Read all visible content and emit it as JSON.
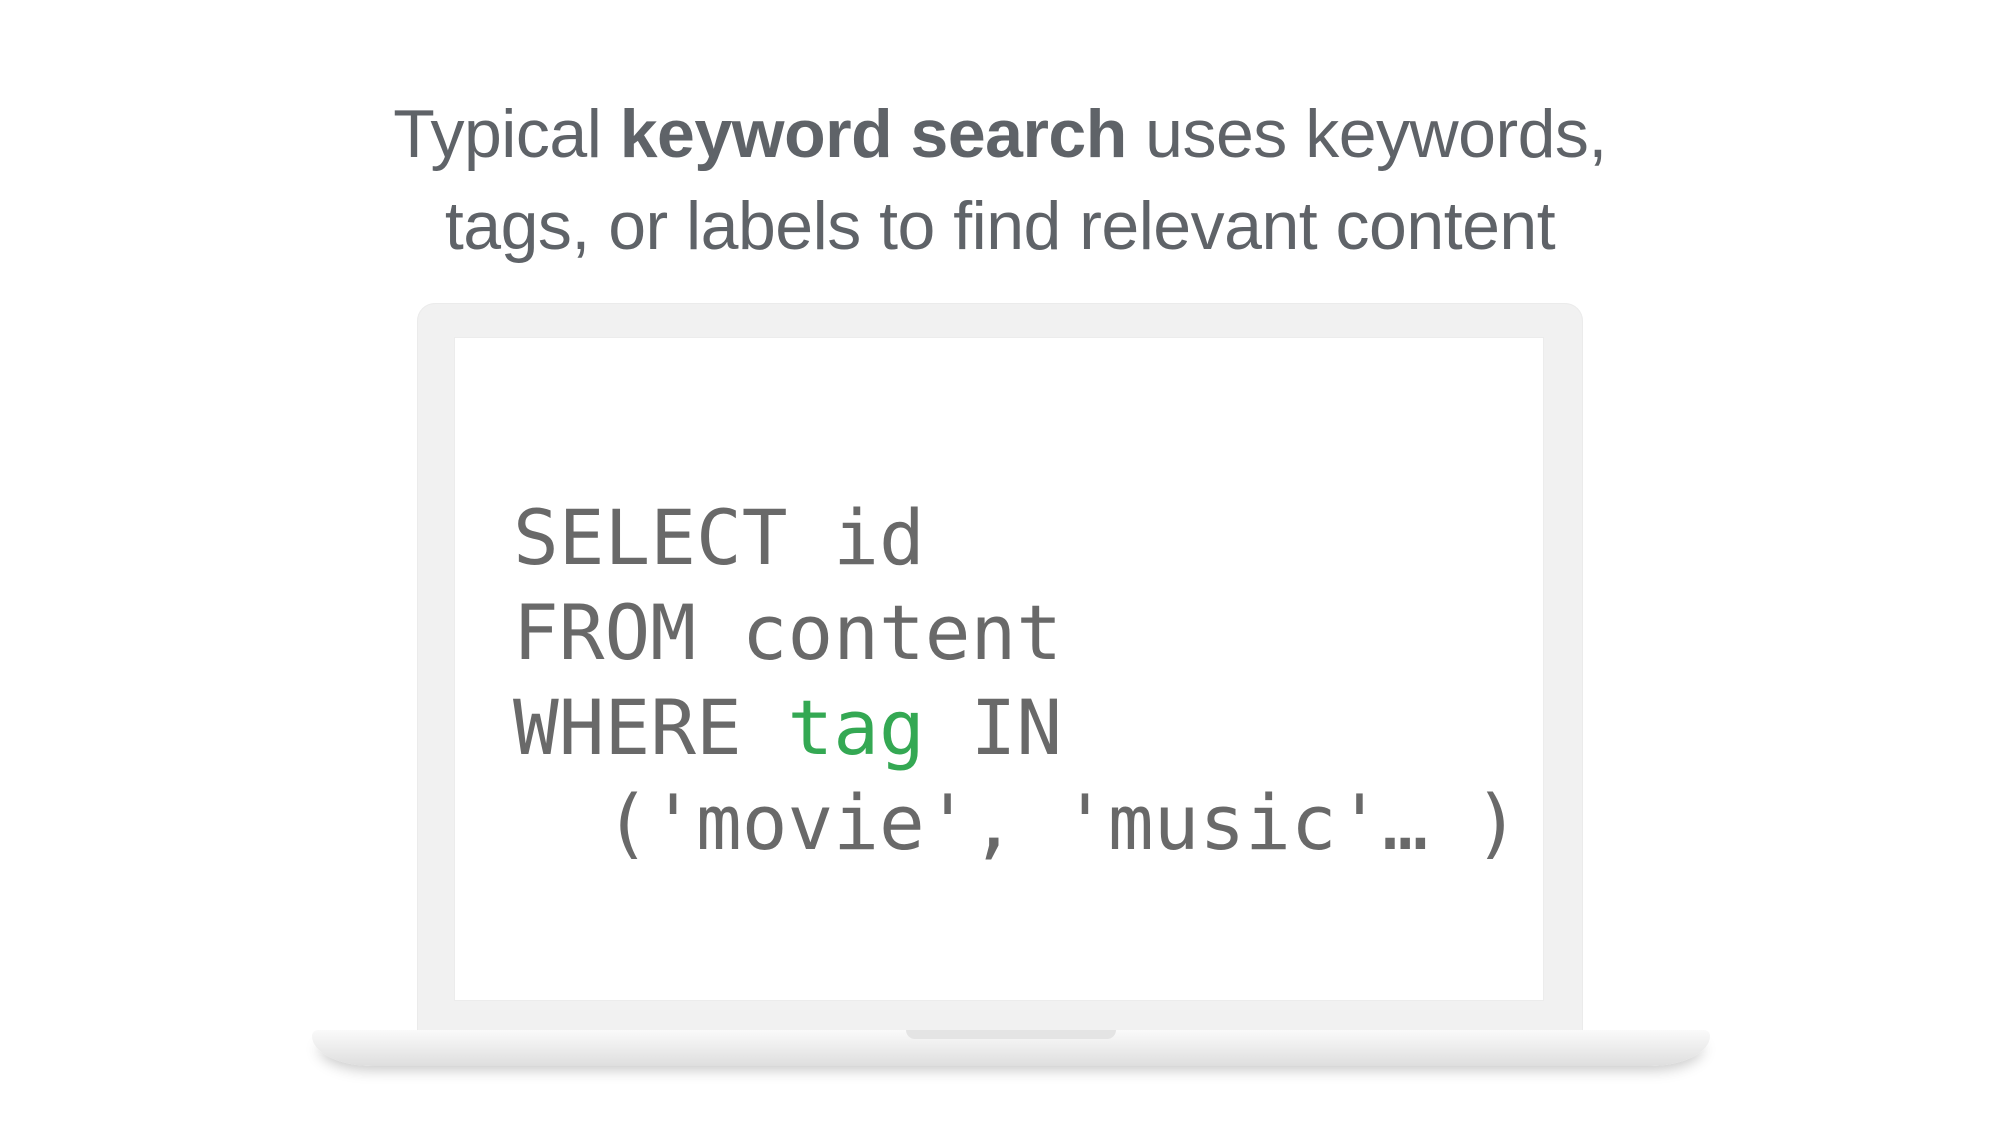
{
  "headline": {
    "line1_pre": "Typical ",
    "line1_bold": "keyword search",
    "line1_post": " uses keywords,",
    "line2": "tags, or labels to find relevant content"
  },
  "code": {
    "line1": "SELECT id",
    "line2": "FROM content",
    "line3_pre": "WHERE ",
    "line3_highlight": "tag",
    "line3_post": " IN",
    "line4": "  ('movie', 'music'… )"
  },
  "colors": {
    "text": "#5f6368",
    "code": "#696969",
    "highlight": "#34a853"
  }
}
